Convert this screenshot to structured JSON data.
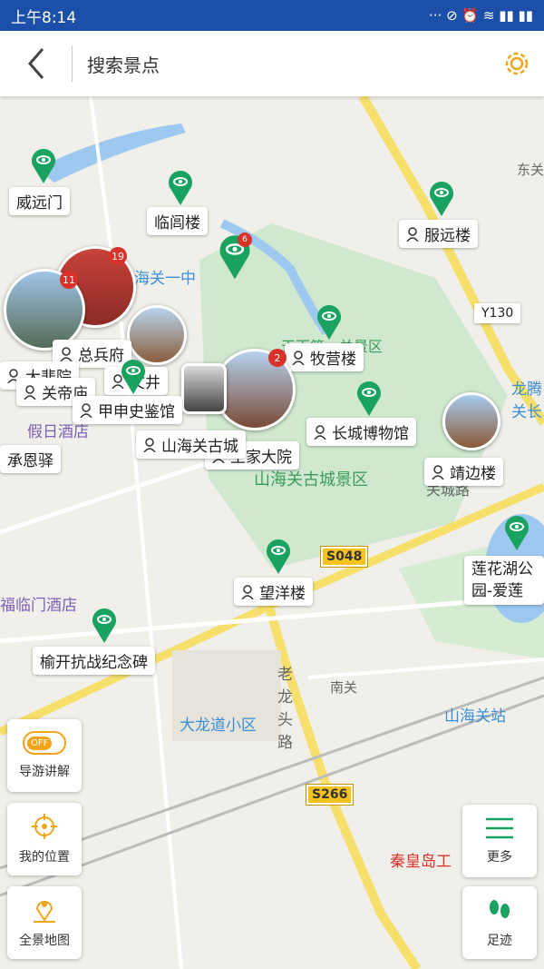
{
  "status": {
    "time": "上午8:14",
    "icons": "··· ⊘ ⏰ ≋ ▮▮ ▮▮"
  },
  "header": {
    "title": "搜索景点"
  },
  "spots": [
    {
      "name": "威远门"
    },
    {
      "name": "临闾楼"
    },
    {
      "name": "服远楼"
    },
    {
      "name": "总兵府"
    },
    {
      "name": "大悲院"
    },
    {
      "name": "牧营楼"
    },
    {
      "name": "甲申史鉴馆"
    },
    {
      "name": "长城博物馆"
    },
    {
      "name": "山海关古城"
    },
    {
      "name": "靖边楼"
    },
    {
      "name": "望洋楼"
    },
    {
      "name": "榆开抗战纪念碑"
    },
    {
      "name": "王家大院"
    },
    {
      "name": "关帝庙"
    },
    {
      "name": "文井"
    },
    {
      "name": "承恩驿"
    },
    {
      "name": "莲花湖公园-爱莲"
    }
  ],
  "badges": {
    "b1": "19",
    "b2": "11",
    "b3": "6",
    "b4": "2"
  },
  "map_labels": {
    "school": "海关一中",
    "hotel1": "假日酒店",
    "hotel2": "福临门酒店",
    "district": "山海关古城景区",
    "district2": "天下第一关景区",
    "community": "大龙道小区",
    "road1": "老龙头路",
    "nanguan": "南关",
    "station": "山海关站",
    "hospital": "秦皇岛工",
    "dongguan": "东关",
    "longteng": "龙腾关长",
    "road_y130": "Y130",
    "road_s048": "S048",
    "road_s266": "S266",
    "road_guancheng": "关城路"
  },
  "controls": {
    "guide": "导游讲解",
    "toggle": "OFF",
    "location": "我的位置",
    "overview": "全景地图",
    "more": "更多",
    "footprint": "足迹"
  },
  "colors": {
    "status_bar": "#1c50a8",
    "pin": "#1aa360",
    "accent": "#f0a418",
    "badge": "#d9322b"
  }
}
